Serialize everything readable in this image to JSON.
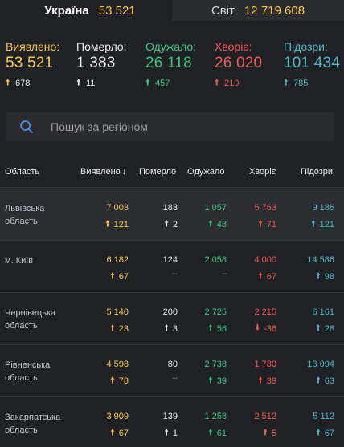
{
  "tabs": [
    {
      "name": "Україна",
      "count": "53 521"
    },
    {
      "name": "Світ",
      "count": "12 719 608"
    }
  ],
  "summary": [
    {
      "label": "Виявлено:",
      "value": "53 521",
      "delta": "678",
      "color": "#f5c64a",
      "arrow": "up"
    },
    {
      "label": "Померло:",
      "value": "1 383",
      "delta": "11",
      "color": "#e8e8e8",
      "arrow": "up"
    },
    {
      "label": "Одужало:",
      "value": "26 118",
      "delta": "457",
      "color": "#3ec480",
      "arrow": "up"
    },
    {
      "label": "Хворіє:",
      "value": "26 020",
      "delta": "210",
      "color": "#ee5a5a",
      "arrow": "up"
    },
    {
      "label": "Підозри:",
      "value": "101 434",
      "delta": "785",
      "color": "#4fb6c6",
      "arrow": "up"
    }
  ],
  "search": {
    "placeholder": "Пошук за регіоном"
  },
  "table": {
    "headers": [
      "Область",
      "Виявлено",
      "Померло",
      "Одужало",
      "Хворіє",
      "Підозри"
    ],
    "sort_indicator": "↓",
    "rows": [
      {
        "name": "Львівська область",
        "confirmed": "7 003",
        "confirmed_delta": "121",
        "deaths": "183",
        "deaths_delta": "2",
        "recovered": "1 057",
        "recovered_delta": "48",
        "sick": "5 763",
        "sick_delta": "71",
        "suspected": "9 186",
        "suspected_delta": "121",
        "highlighted": true
      },
      {
        "name": "м. Київ",
        "confirmed": "6 182",
        "confirmed_delta": "67",
        "deaths": "124",
        "deaths_delta": "–",
        "recovered": "2 058",
        "recovered_delta": "–",
        "sick": "4 000",
        "sick_delta": "67",
        "suspected": "14 586",
        "suspected_delta": "98",
        "highlighted": false
      },
      {
        "name": "Чернівецька область",
        "confirmed": "5 140",
        "confirmed_delta": "23",
        "deaths": "200",
        "deaths_delta": "3",
        "recovered": "2 725",
        "recovered_delta": "56",
        "sick": "2 215",
        "sick_delta": "-36",
        "suspected": "6 161",
        "suspected_delta": "28",
        "highlighted": false
      },
      {
        "name": "Рівненська область",
        "confirmed": "4 598",
        "confirmed_delta": "78",
        "deaths": "80",
        "deaths_delta": "–",
        "recovered": "2 738",
        "recovered_delta": "39",
        "sick": "1 780",
        "sick_delta": "39",
        "suspected": "13 094",
        "suspected_delta": "63",
        "highlighted": false
      },
      {
        "name": "Закарпатська область",
        "confirmed": "3 909",
        "confirmed_delta": "67",
        "deaths": "139",
        "deaths_delta": "1",
        "recovered": "1 258",
        "recovered_delta": "61",
        "sick": "2 512",
        "sick_delta": "5",
        "suspected": "5 112",
        "suspected_delta": "67",
        "highlighted": false
      }
    ]
  }
}
